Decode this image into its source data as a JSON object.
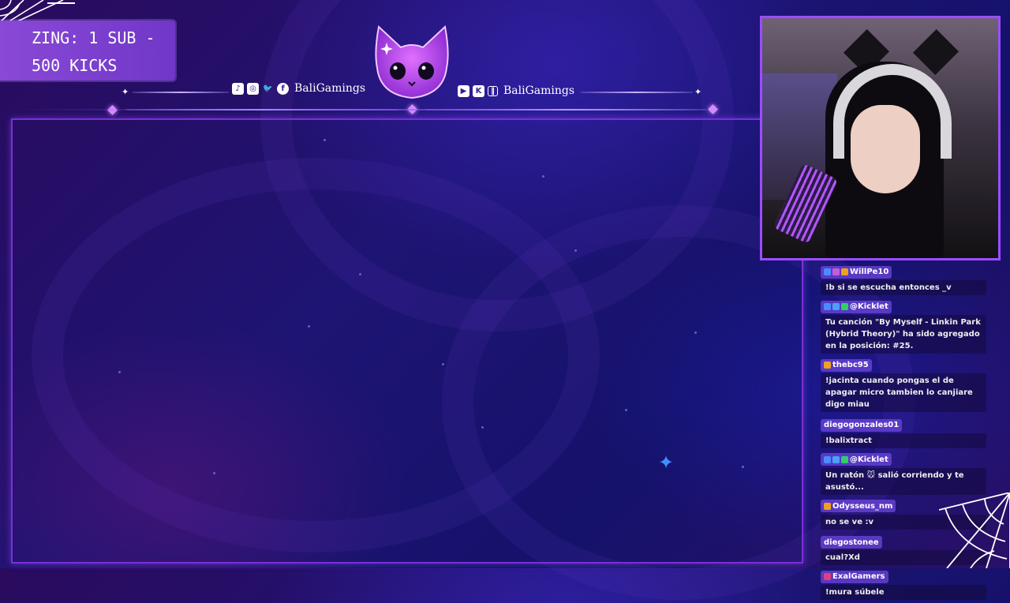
{
  "goal": {
    "line1": "ZING: 1 SUB -",
    "line2": "500 KICKS"
  },
  "header": {
    "left_handle": "BaliGamings",
    "right_handle": "BaliGamings",
    "left_icons": [
      "tiktok-icon",
      "instagram-icon",
      "twitter-icon",
      "facebook-icon"
    ],
    "right_icons": [
      "youtube-icon",
      "kick-icon",
      "twitch-icon"
    ]
  },
  "chat": {
    "messages": [
      {
        "user": "WillPe10",
        "badges": [
          "#4a8cff",
          "#c85bd8",
          "#f0a020"
        ],
        "text": "!b si se escucha entonces _v"
      },
      {
        "user": "@Kicklet",
        "badges": [
          "#4a8cff",
          "#4aa0ff",
          "#2fd06a"
        ],
        "text": "Tu canción \"By Myself - Linkin Park (Hybrid Theory)\" ha sido agregado en la posición: #25."
      },
      {
        "user": "thebc95",
        "badges": [
          "#f0a020"
        ],
        "text": "!jacinta cuando pongas el de apagar micro tambien lo canjiare digo miau"
      },
      {
        "user": "diegogonzales01",
        "badges": [],
        "text": "!balixtract"
      },
      {
        "user": "@Kicklet",
        "badges": [
          "#4a8cff",
          "#4aa0ff",
          "#2fd06a"
        ],
        "text": "Un ratón 🐭 salió corriendo y te asustó..."
      },
      {
        "user": "Odysseus_nm",
        "badges": [
          "#f0a020"
        ],
        "text": "no se ve :v"
      },
      {
        "user": "diegostonee",
        "badges": [],
        "text": "cual?Xd"
      },
      {
        "user": "ExalGamers",
        "badges": [
          "#e04080"
        ],
        "text": "!mura súbele"
      }
    ]
  },
  "colors": {
    "accent": "#9b4dff",
    "frame": "#7a2fd6",
    "goal_bg": "#7d40cf"
  }
}
